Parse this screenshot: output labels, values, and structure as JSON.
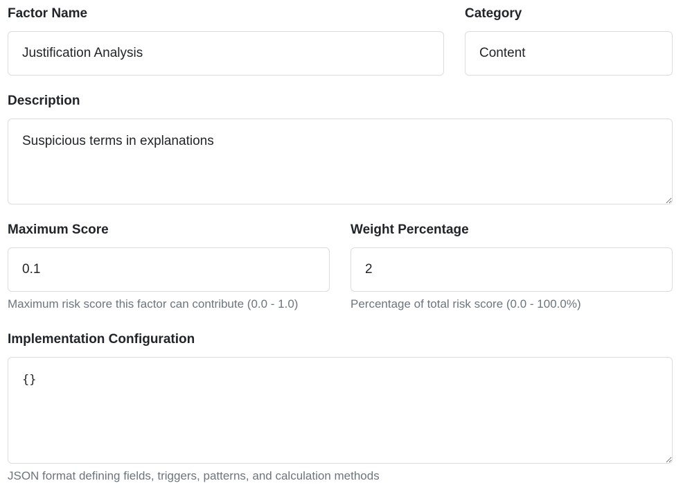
{
  "form": {
    "factor_name": {
      "label": "Factor Name",
      "value": "Justification Analysis"
    },
    "category": {
      "label": "Category",
      "value": "Content"
    },
    "description": {
      "label": "Description",
      "value": "Suspicious terms in explanations"
    },
    "maximum_score": {
      "label": "Maximum Score",
      "value": "0.1",
      "help": "Maximum risk score this factor can contribute (0.0 - 1.0)"
    },
    "weight_percentage": {
      "label": "Weight Percentage",
      "value": "2",
      "help": "Percentage of total risk score (0.0 - 100.0%)"
    },
    "implementation_config": {
      "label": "Implementation Configuration",
      "value": "{}",
      "help": "JSON format defining fields, triggers, patterns, and calculation methods"
    }
  }
}
